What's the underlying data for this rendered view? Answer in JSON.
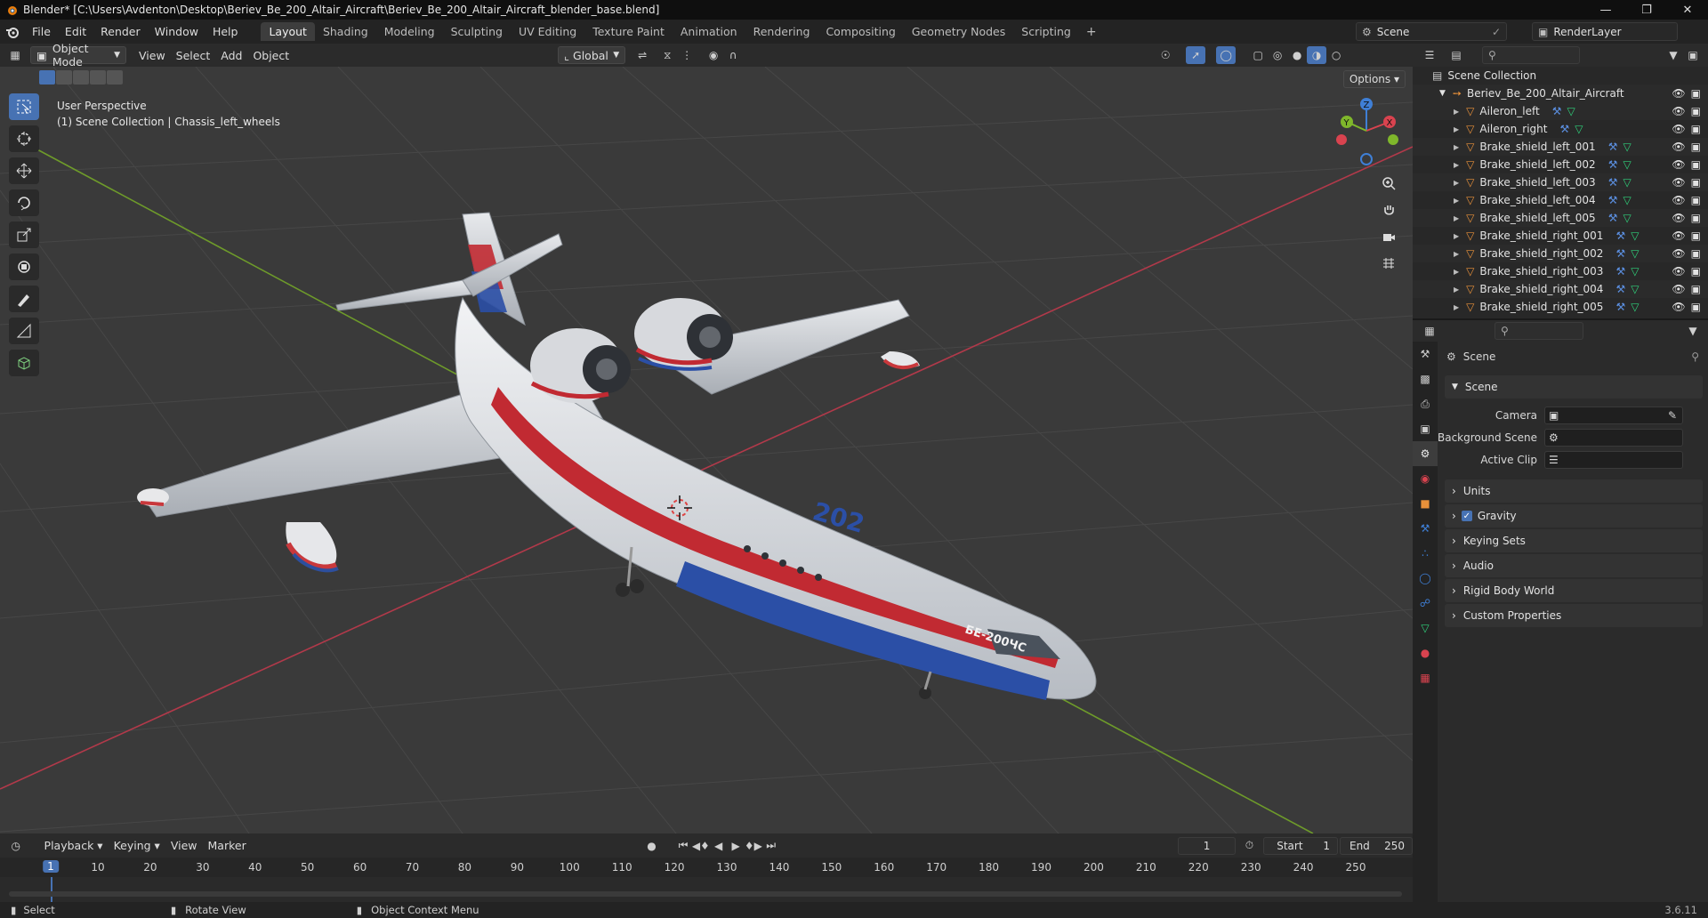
{
  "window": {
    "title": "Blender* [C:\\Users\\Avdenton\\Desktop\\Beriev_Be_200_Altair_Aircraft\\Beriev_Be_200_Altair_Aircraft_blender_base.blend]"
  },
  "menu": [
    "File",
    "Edit",
    "Render",
    "Window",
    "Help"
  ],
  "workspaces": [
    "Layout",
    "Shading",
    "Modeling",
    "Sculpting",
    "UV Editing",
    "Texture Paint",
    "Animation",
    "Rendering",
    "Compositing",
    "Geometry Nodes",
    "Scripting"
  ],
  "active_workspace": "Layout",
  "scene_name": "Scene",
  "view_layer": "RenderLayer",
  "viewport_header": {
    "mode": "Object Mode",
    "menus": [
      "View",
      "Select",
      "Add",
      "Object"
    ],
    "transform_orientation": "Global",
    "options": "Options"
  },
  "viewport": {
    "perspective": "User Perspective",
    "context": "(1) Scene Collection | Chassis_left_wheels",
    "livery_number": "202",
    "livery_name": "БЕ-200ЧС"
  },
  "outliner": {
    "root": "Scene Collection",
    "collection": "Beriev_Be_200_Altair_Aircraft",
    "objects": [
      "Aileron_left",
      "Aileron_right",
      "Brake_shield_left_001",
      "Brake_shield_left_002",
      "Brake_shield_left_003",
      "Brake_shield_left_004",
      "Brake_shield_left_005",
      "Brake_shield_right_001",
      "Brake_shield_right_002",
      "Brake_shield_right_003",
      "Brake_shield_right_004",
      "Brake_shield_right_005"
    ]
  },
  "properties": {
    "context_title": "Scene",
    "panel_title": "Scene",
    "camera_label": "Camera",
    "background_scene_label": "Background Scene",
    "active_clip_label": "Active Clip",
    "sections": [
      "Units",
      "Gravity",
      "Keying Sets",
      "Audio",
      "Rigid Body World",
      "Custom Properties"
    ],
    "gravity_checked": true
  },
  "timeline": {
    "menus": [
      "Playback",
      "Keying",
      "View",
      "Marker"
    ],
    "current_frame": "1",
    "start_label": "Start",
    "start": "1",
    "end_label": "End",
    "end": "250",
    "ticks": [
      "10",
      "20",
      "30",
      "40",
      "50",
      "60",
      "70",
      "80",
      "90",
      "100",
      "110",
      "120",
      "130",
      "140",
      "150",
      "160",
      "170",
      "180",
      "190",
      "200",
      "210",
      "220",
      "230",
      "240",
      "250"
    ]
  },
  "statusbar": {
    "select": "Select",
    "rotate": "Rotate View",
    "context_menu": "Object Context Menu",
    "version": "3.6.11"
  },
  "colors": {
    "accent": "#4772b3",
    "x_axis": "#d9434f",
    "y_axis": "#7fb72b",
    "z_axis": "#3f7fd6",
    "object_orange": "#e8913a"
  }
}
